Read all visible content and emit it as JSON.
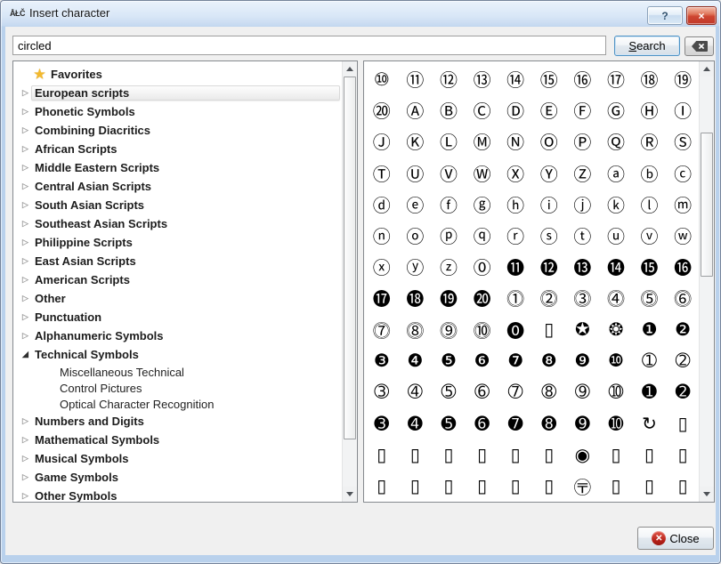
{
  "window": {
    "icon_text": "ÅŁČ",
    "title": "Insert character",
    "help_label": "?",
    "close_glyph": "×"
  },
  "search": {
    "value": "circled",
    "button_label": "Search"
  },
  "tree": {
    "items": [
      {
        "label": "Favorites",
        "state": "favorites"
      },
      {
        "label": "European scripts",
        "state": "collapsed",
        "selected": true
      },
      {
        "label": "Phonetic Symbols",
        "state": "collapsed"
      },
      {
        "label": "Combining Diacritics",
        "state": "collapsed"
      },
      {
        "label": "African Scripts",
        "state": "collapsed"
      },
      {
        "label": "Middle Eastern Scripts",
        "state": "collapsed"
      },
      {
        "label": "Central Asian Scripts",
        "state": "collapsed"
      },
      {
        "label": "South Asian Scripts",
        "state": "collapsed"
      },
      {
        "label": "Southeast Asian Scripts",
        "state": "collapsed"
      },
      {
        "label": "Philippine Scripts",
        "state": "collapsed"
      },
      {
        "label": "East Asian Scripts",
        "state": "collapsed"
      },
      {
        "label": "American Scripts",
        "state": "collapsed"
      },
      {
        "label": "Other",
        "state": "collapsed"
      },
      {
        "label": "Punctuation",
        "state": "collapsed"
      },
      {
        "label": "Alphanumeric Symbols",
        "state": "collapsed"
      },
      {
        "label": "Technical Symbols",
        "state": "expanded"
      },
      {
        "label": "Miscellaneous Technical",
        "state": "child"
      },
      {
        "label": "Control Pictures",
        "state": "child"
      },
      {
        "label": "Optical Character Recognition",
        "state": "child"
      },
      {
        "label": "Numbers and Digits",
        "state": "collapsed"
      },
      {
        "label": "Mathematical Symbols",
        "state": "collapsed"
      },
      {
        "label": "Musical Symbols",
        "state": "collapsed"
      },
      {
        "label": "Game Symbols",
        "state": "collapsed"
      },
      {
        "label": "Other Symbols",
        "state": "collapsed"
      }
    ]
  },
  "chargrid": {
    "rows": [
      [
        "⑩",
        "⑪",
        "⑫",
        "⑬",
        "⑭",
        "⑮",
        "⑯",
        "⑰",
        "⑱",
        "⑲"
      ],
      [
        "⑳",
        "Ⓐ",
        "Ⓑ",
        "Ⓒ",
        "Ⓓ",
        "Ⓔ",
        "Ⓕ",
        "Ⓖ",
        "Ⓗ",
        "Ⓘ"
      ],
      [
        "Ⓙ",
        "Ⓚ",
        "Ⓛ",
        "Ⓜ",
        "Ⓝ",
        "Ⓞ",
        "Ⓟ",
        "Ⓠ",
        "Ⓡ",
        "Ⓢ"
      ],
      [
        "Ⓣ",
        "Ⓤ",
        "Ⓥ",
        "Ⓦ",
        "Ⓧ",
        "Ⓨ",
        "Ⓩ",
        "ⓐ",
        "ⓑ",
        "ⓒ"
      ],
      [
        "ⓓ",
        "ⓔ",
        "ⓕ",
        "ⓖ",
        "ⓗ",
        "ⓘ",
        "ⓙ",
        "ⓚ",
        "ⓛ",
        "ⓜ"
      ],
      [
        "ⓝ",
        "ⓞ",
        "ⓟ",
        "ⓠ",
        "ⓡ",
        "ⓢ",
        "ⓣ",
        "ⓤ",
        "ⓥ",
        "ⓦ"
      ],
      [
        "ⓧ",
        "ⓨ",
        "ⓩ",
        "⓪",
        "⓫",
        "⓬",
        "⓭",
        "⓮",
        "⓯",
        "⓰"
      ],
      [
        "⓱",
        "⓲",
        "⓳",
        "⓴",
        "⓵",
        "⓶",
        "⓷",
        "⓸",
        "⓹",
        "⓺"
      ],
      [
        "⓻",
        "⓼",
        "⓽",
        "⓾",
        "⓿",
        "▯",
        "✪",
        "❂",
        "❶",
        "❷"
      ],
      [
        "❸",
        "❹",
        "❺",
        "❻",
        "❼",
        "❽",
        "❾",
        "❿",
        "➀",
        "➁"
      ],
      [
        "➂",
        "➃",
        "➄",
        "➅",
        "➆",
        "➇",
        "➈",
        "➉",
        "➊",
        "➋"
      ],
      [
        "➌",
        "➍",
        "➎",
        "➏",
        "➐",
        "➑",
        "➒",
        "➓",
        "↻",
        "▯"
      ],
      [
        "▯",
        "▯",
        "▯",
        "▯",
        "▯",
        "▯",
        "◉",
        "▯",
        "▯",
        "▯"
      ],
      [
        "▯",
        "▯",
        "▯",
        "▯",
        "▯",
        "▯",
        "〶",
        "▯",
        "▯",
        "▯"
      ]
    ]
  },
  "footer": {
    "close_label": "Close",
    "close_icon_glyph": "✕"
  },
  "colors": {
    "close_accent": "#b31f17",
    "favorites_star": "#f3b92d",
    "selection_border": "#d9d9d9"
  }
}
